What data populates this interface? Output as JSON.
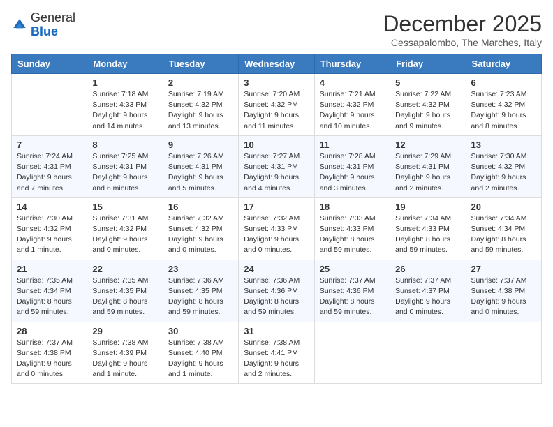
{
  "logo": {
    "general": "General",
    "blue": "Blue"
  },
  "header": {
    "month": "December 2025",
    "location": "Cessapalombo, The Marches, Italy"
  },
  "weekdays": [
    "Sunday",
    "Monday",
    "Tuesday",
    "Wednesday",
    "Thursday",
    "Friday",
    "Saturday"
  ],
  "weeks": [
    [
      {
        "day": "",
        "info": ""
      },
      {
        "day": "1",
        "info": "Sunrise: 7:18 AM\nSunset: 4:33 PM\nDaylight: 9 hours\nand 14 minutes."
      },
      {
        "day": "2",
        "info": "Sunrise: 7:19 AM\nSunset: 4:32 PM\nDaylight: 9 hours\nand 13 minutes."
      },
      {
        "day": "3",
        "info": "Sunrise: 7:20 AM\nSunset: 4:32 PM\nDaylight: 9 hours\nand 11 minutes."
      },
      {
        "day": "4",
        "info": "Sunrise: 7:21 AM\nSunset: 4:32 PM\nDaylight: 9 hours\nand 10 minutes."
      },
      {
        "day": "5",
        "info": "Sunrise: 7:22 AM\nSunset: 4:32 PM\nDaylight: 9 hours\nand 9 minutes."
      },
      {
        "day": "6",
        "info": "Sunrise: 7:23 AM\nSunset: 4:32 PM\nDaylight: 9 hours\nand 8 minutes."
      }
    ],
    [
      {
        "day": "7",
        "info": "Sunrise: 7:24 AM\nSunset: 4:31 PM\nDaylight: 9 hours\nand 7 minutes."
      },
      {
        "day": "8",
        "info": "Sunrise: 7:25 AM\nSunset: 4:31 PM\nDaylight: 9 hours\nand 6 minutes."
      },
      {
        "day": "9",
        "info": "Sunrise: 7:26 AM\nSunset: 4:31 PM\nDaylight: 9 hours\nand 5 minutes."
      },
      {
        "day": "10",
        "info": "Sunrise: 7:27 AM\nSunset: 4:31 PM\nDaylight: 9 hours\nand 4 minutes."
      },
      {
        "day": "11",
        "info": "Sunrise: 7:28 AM\nSunset: 4:31 PM\nDaylight: 9 hours\nand 3 minutes."
      },
      {
        "day": "12",
        "info": "Sunrise: 7:29 AM\nSunset: 4:31 PM\nDaylight: 9 hours\nand 2 minutes."
      },
      {
        "day": "13",
        "info": "Sunrise: 7:30 AM\nSunset: 4:32 PM\nDaylight: 9 hours\nand 2 minutes."
      }
    ],
    [
      {
        "day": "14",
        "info": "Sunrise: 7:30 AM\nSunset: 4:32 PM\nDaylight: 9 hours\nand 1 minute."
      },
      {
        "day": "15",
        "info": "Sunrise: 7:31 AM\nSunset: 4:32 PM\nDaylight: 9 hours\nand 0 minutes."
      },
      {
        "day": "16",
        "info": "Sunrise: 7:32 AM\nSunset: 4:32 PM\nDaylight: 9 hours\nand 0 minutes."
      },
      {
        "day": "17",
        "info": "Sunrise: 7:32 AM\nSunset: 4:33 PM\nDaylight: 9 hours\nand 0 minutes."
      },
      {
        "day": "18",
        "info": "Sunrise: 7:33 AM\nSunset: 4:33 PM\nDaylight: 8 hours\nand 59 minutes."
      },
      {
        "day": "19",
        "info": "Sunrise: 7:34 AM\nSunset: 4:33 PM\nDaylight: 8 hours\nand 59 minutes."
      },
      {
        "day": "20",
        "info": "Sunrise: 7:34 AM\nSunset: 4:34 PM\nDaylight: 8 hours\nand 59 minutes."
      }
    ],
    [
      {
        "day": "21",
        "info": "Sunrise: 7:35 AM\nSunset: 4:34 PM\nDaylight: 8 hours\nand 59 minutes."
      },
      {
        "day": "22",
        "info": "Sunrise: 7:35 AM\nSunset: 4:35 PM\nDaylight: 8 hours\nand 59 minutes."
      },
      {
        "day": "23",
        "info": "Sunrise: 7:36 AM\nSunset: 4:35 PM\nDaylight: 8 hours\nand 59 minutes."
      },
      {
        "day": "24",
        "info": "Sunrise: 7:36 AM\nSunset: 4:36 PM\nDaylight: 8 hours\nand 59 minutes."
      },
      {
        "day": "25",
        "info": "Sunrise: 7:37 AM\nSunset: 4:36 PM\nDaylight: 8 hours\nand 59 minutes."
      },
      {
        "day": "26",
        "info": "Sunrise: 7:37 AM\nSunset: 4:37 PM\nDaylight: 9 hours\nand 0 minutes."
      },
      {
        "day": "27",
        "info": "Sunrise: 7:37 AM\nSunset: 4:38 PM\nDaylight: 9 hours\nand 0 minutes."
      }
    ],
    [
      {
        "day": "28",
        "info": "Sunrise: 7:37 AM\nSunset: 4:38 PM\nDaylight: 9 hours\nand 0 minutes."
      },
      {
        "day": "29",
        "info": "Sunrise: 7:38 AM\nSunset: 4:39 PM\nDaylight: 9 hours\nand 1 minute."
      },
      {
        "day": "30",
        "info": "Sunrise: 7:38 AM\nSunset: 4:40 PM\nDaylight: 9 hours\nand 1 minute."
      },
      {
        "day": "31",
        "info": "Sunrise: 7:38 AM\nSunset: 4:41 PM\nDaylight: 9 hours\nand 2 minutes."
      },
      {
        "day": "",
        "info": ""
      },
      {
        "day": "",
        "info": ""
      },
      {
        "day": "",
        "info": ""
      }
    ]
  ]
}
